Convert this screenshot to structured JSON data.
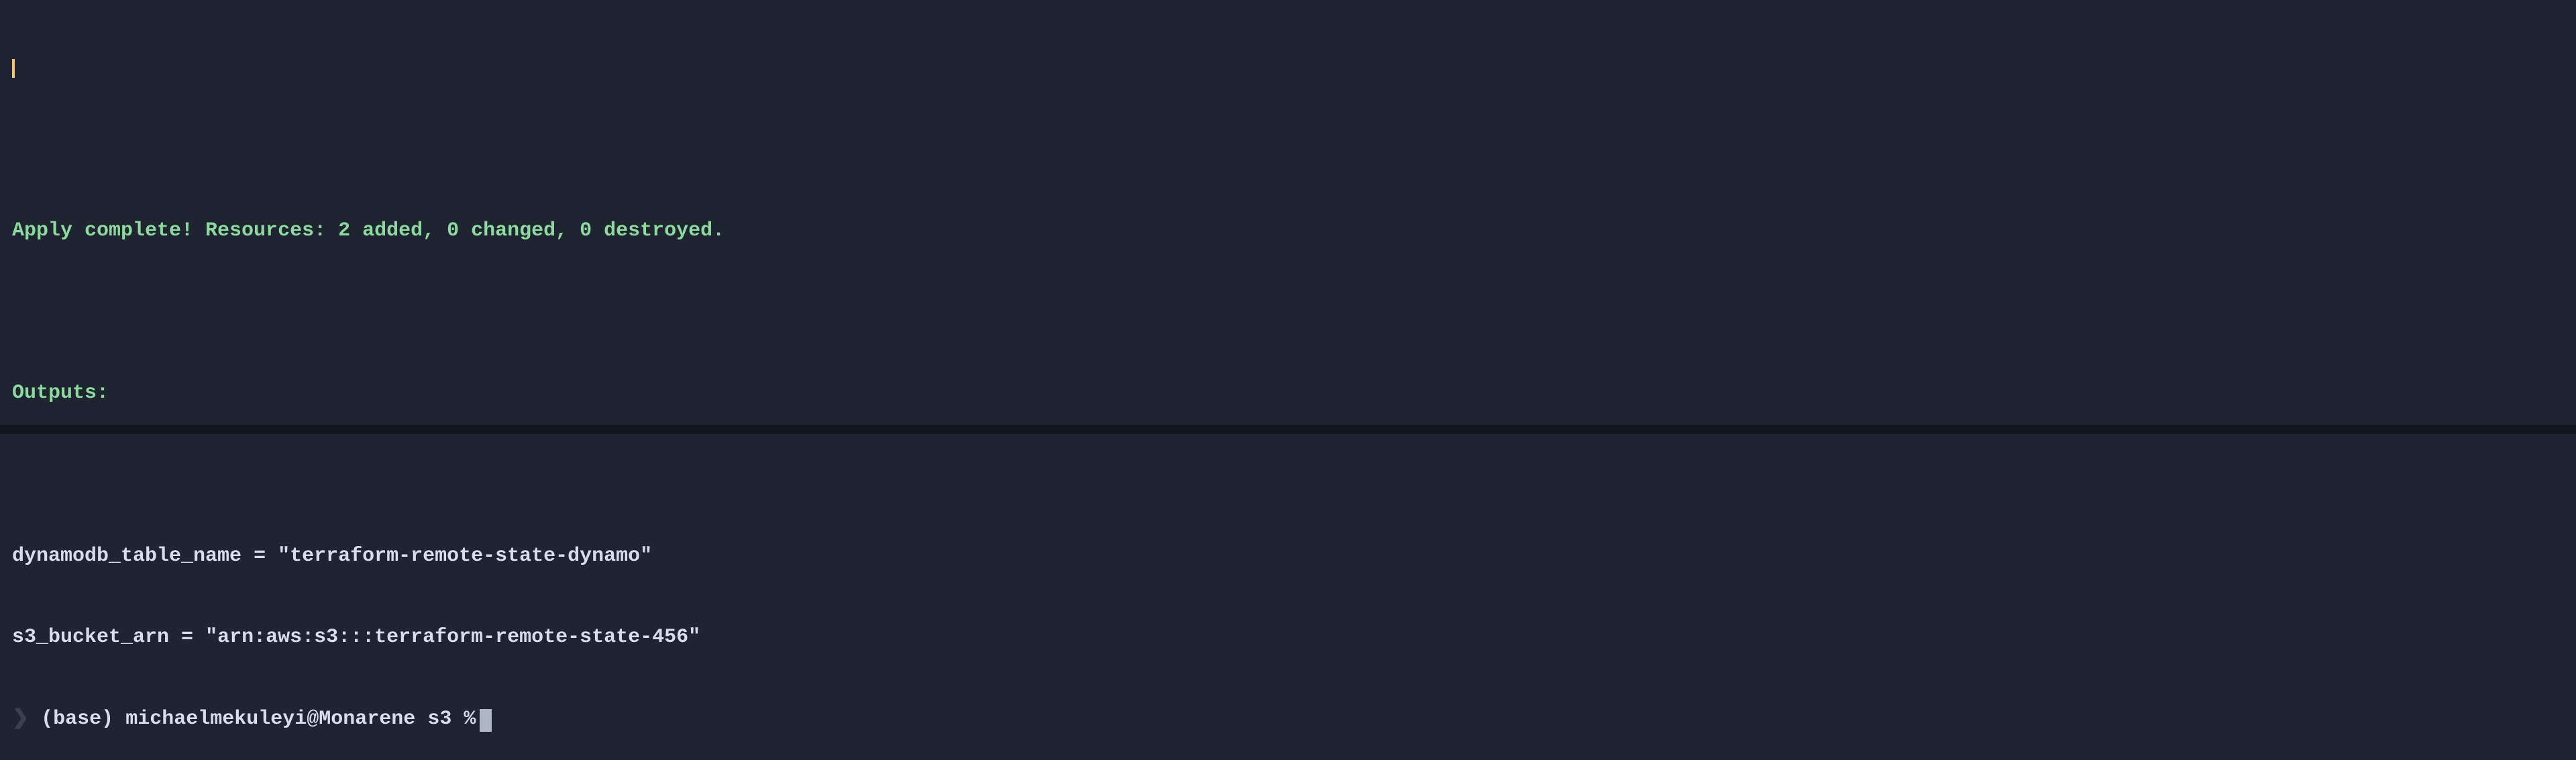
{
  "terminal": {
    "apply_complete": "Apply complete! Resources: 2 added, 0 changed, 0 destroyed.",
    "outputs_header": "Outputs:",
    "outputs": {
      "dynamodb_key": "dynamodb_table_name",
      "dynamodb_value": "\"terraform-remote-state-dynamo\"",
      "s3_key": "s3_bucket_arn",
      "s3_value": "\"arn:aws:s3:::terraform-remote-state-456\""
    },
    "prompt": {
      "env": "(base)",
      "user": "michaelmekuleyi",
      "at": "@",
      "host": "Monarene",
      "dir": "s3",
      "symbol": "%"
    }
  }
}
